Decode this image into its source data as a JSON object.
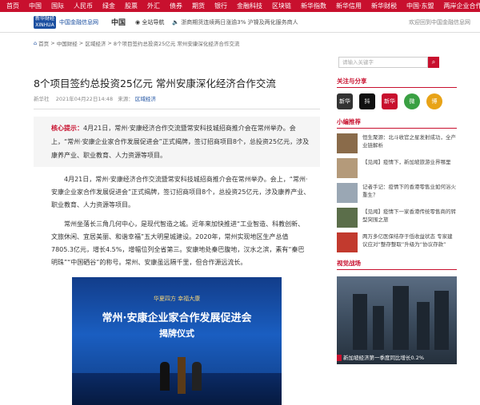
{
  "topnav": [
    "首页",
    "中国",
    "国际",
    "人民币",
    "绿金",
    "股票",
    "外汇",
    "债券",
    "期货",
    "银行",
    "金融科技",
    "区块链",
    "新华指数",
    "新华信用",
    "新华财税",
    "中国·东盟",
    "两岸企业合作",
    "直播",
    "快看"
  ],
  "header": {
    "logo": "新华财经 XINHUA FINANCE",
    "site": "中国金融信息网",
    "country": "中国",
    "nav": "全站导航",
    "ticker": "浙商期货连续两日涨逾3% 沪镍及两化服务商人",
    "right": "欢迎回到中国金融信息网"
  },
  "breadcrumb": {
    "home": "首页",
    "c1": "中国财经",
    "c2": "区域经济",
    "c3": "8个项目签约总投资25亿元 常州安康深化经济合作交流"
  },
  "search": {
    "placeholder": "请输入关键字",
    "btn": "⌕"
  },
  "article": {
    "title": "8个项目签约总投资25亿元 常州安康深化经济合作交流",
    "source": "新华社",
    "date": "2021年04月22日14:48",
    "from": "来源：",
    "src": "区域经济",
    "summary_label": "核心提示：",
    "summary": "4月21日，常州·安康经济合作交流暨常安科技城招商推介会在常州举办。会上，“常州·安康企业家合作发展促进会”正式揭牌，签订招商项目8个，总投资25亿元，涉及康养产业、职业教育、人力资源等项目。",
    "p1": "4月21日，常州·安康经济合作交流暨常安科技城招商推介会在常州举办。会上，“常州·安康企业家合作发展促进会”正式揭牌，签订招商项目8个，总投资25亿元，涉及康养产业、职业教育、人力资源等项目。",
    "p2": "常州坐落长三角几何中心，是现代智造之城。近年来加快推进“工业智造、科教创新、文旅休闲、宜居美丽、和谐幸福”五大明星城建设。2020年，常州实现地区生产总值7805.3亿元，增长4.5%，增幅位列全省第三。安康地处秦巴腹地，汉水之滨，素有“秦巴明珠”“中国硒谷”的称号。常州、安康虽远隔千里，但合作源远流长。",
    "photo_b1": "华夏四方 幸福大康",
    "photo_b2": "常州·安康企业家合作发展促进会",
    "photo_b3": "揭牌仪式"
  },
  "side": {
    "share_h": "关注与分享",
    "share": [
      "新华",
      "抖",
      "新华",
      "微",
      "博"
    ],
    "news_h": "小编推荐",
    "news": [
      "恒生聚源：北斗收官之星发射成功，全产业链解析",
      "【见闻】疫情下，新加坡旅游业界哪里",
      "记者手记：疫情下的香港零售业如何浴火重生？",
      "【见闻】疫情下一家香港传统零售商的转型突围之旅",
      "两万多亿医保结存于低收益状态 专家建议应对“整存整取”升级为“协议存款”",
      ""
    ],
    "video_h": "视觉战场",
    "video_cap": "新加坡经济第一季度同比增长0.2%"
  }
}
